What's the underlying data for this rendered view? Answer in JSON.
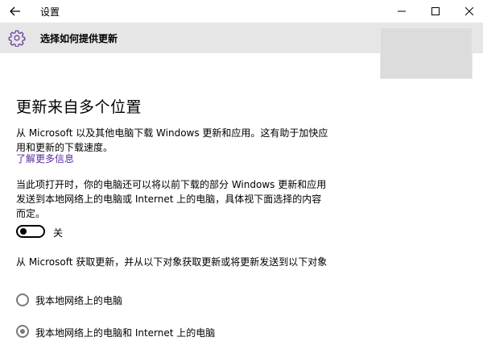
{
  "window": {
    "title": "设置",
    "back_icon": "arrow-left-icon",
    "controls": [
      "minimize-icon",
      "maximize-icon",
      "close-icon"
    ]
  },
  "header": {
    "icon": "gear-icon",
    "title": "选择如何提供更新"
  },
  "main": {
    "title": "更新来自多个位置",
    "description": "从 Microsoft 以及其他电脑下载 Windows 更新和应用。这有助于加快应用和更新的下载速度。",
    "learn_more": "了解更多信息",
    "toggle_description": "当此项打开时，你的电脑还可以将以前下载的部分 Windows 更新和应用发送到本地网络上的电脑或 Internet 上的电脑，具体视下面选择的内容而定。",
    "toggle": {
      "state": "off",
      "label": "关"
    },
    "options_description": "从 Microsoft 获取更新，并从以下对象获取更新或将更新发送到以下对象",
    "options": [
      {
        "label": "我本地网络上的电脑",
        "selected": false
      },
      {
        "label": "我本地网络上的电脑和 Internet 上的电脑",
        "selected": true
      }
    ]
  },
  "colors": {
    "header_bg": "#e6e6e6",
    "link": "#5a2ba0",
    "gear_icon": "#6b3fa0",
    "radio_disabled": "#7a7a7a"
  }
}
